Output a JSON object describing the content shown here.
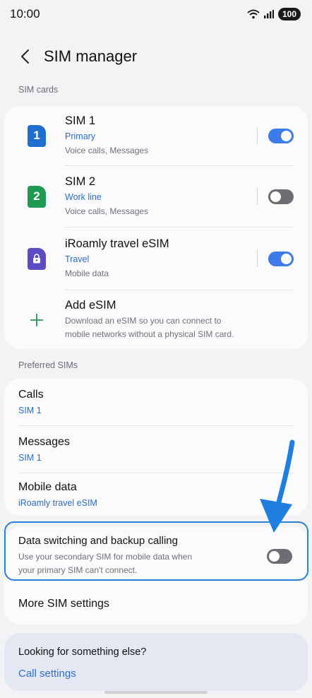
{
  "status_bar": {
    "time": "10:00",
    "battery": "100"
  },
  "header": {
    "title": "SIM manager"
  },
  "sim_cards": {
    "section_label": "SIM cards",
    "items": [
      {
        "number": "1",
        "title": "SIM 1",
        "subtitle": "Primary",
        "description": "Voice calls, Messages",
        "color": "#1f6fd0",
        "enabled": true
      },
      {
        "number": "2",
        "title": "SIM 2",
        "subtitle": "Work line",
        "description": "Voice calls, Messages",
        "color": "#1e9a52",
        "enabled": false
      },
      {
        "number": "",
        "title": "iRoamly travel eSIM",
        "subtitle": "Travel",
        "description": "Mobile data",
        "color": "#5b4bc4",
        "enabled": true
      }
    ],
    "add_esim": {
      "title": "Add eSIM",
      "description_line1": "Download an eSIM so you can connect to",
      "description_line2": "mobile networks without a physical SIM card."
    }
  },
  "preferred": {
    "section_label": "Preferred SIMs",
    "items": [
      {
        "title": "Calls",
        "value": "SIM 1"
      },
      {
        "title": "Messages",
        "value": "SIM 1"
      },
      {
        "title": "Mobile data",
        "value": "iRoamly travel eSIM"
      }
    ]
  },
  "data_switching": {
    "title": "Data switching and backup calling",
    "description_line1": "Use your secondary SIM for mobile data when",
    "description_line2": "your primary SIM can't connect.",
    "enabled": false
  },
  "more_settings": {
    "label": "More SIM settings"
  },
  "footer": {
    "title": "Looking for something else?",
    "link": "Call settings"
  },
  "colors": {
    "accent": "#2a6ccd",
    "toggle_on": "#3d7bea",
    "highlight": "#2a7fd6"
  }
}
